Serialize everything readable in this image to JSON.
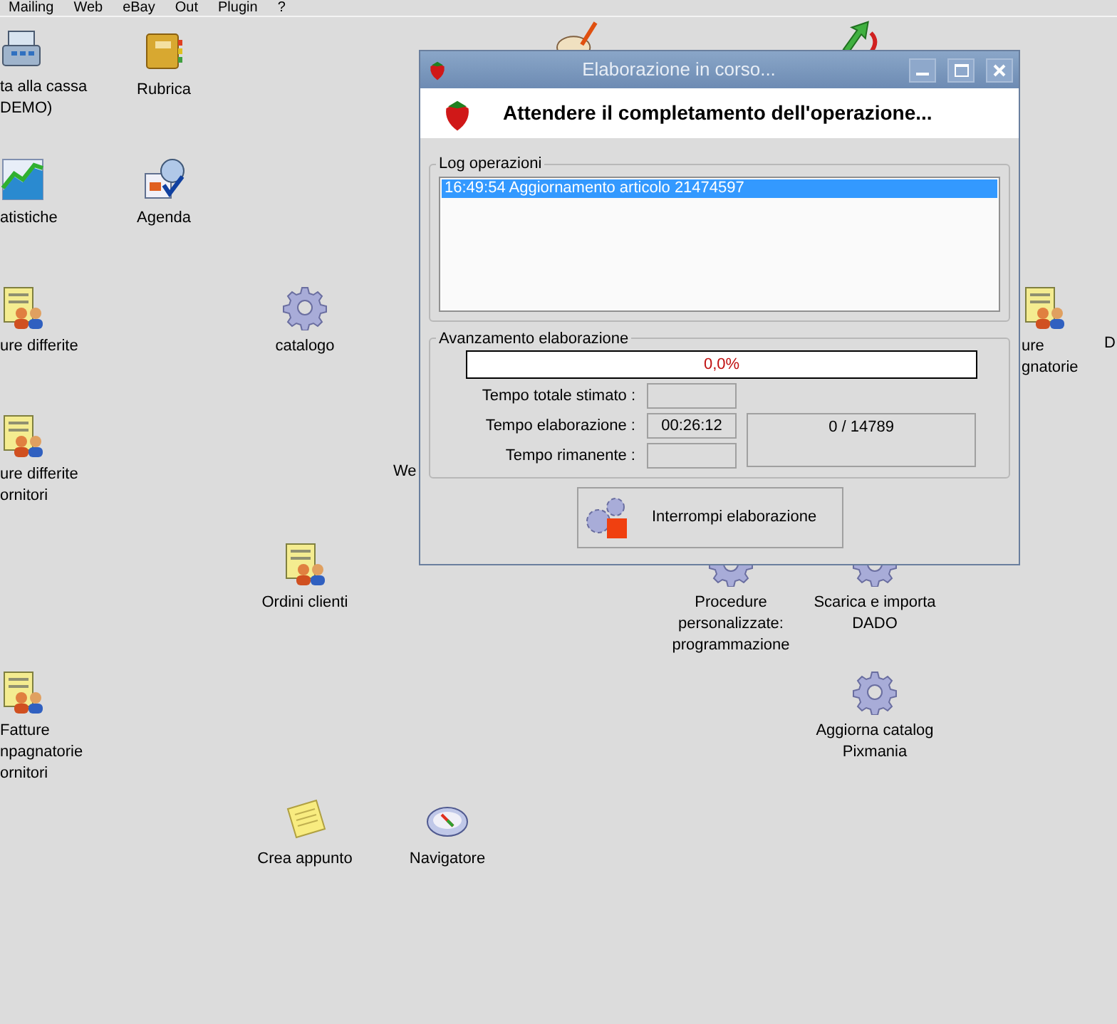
{
  "menu_bar": [
    "Mailing",
    "Web",
    "eBay",
    "Out",
    "Plugin",
    "?"
  ],
  "desktop_icons": [
    {
      "kind": "register",
      "label": [
        "ta alla cassa",
        "DEMO)"
      ]
    },
    {
      "kind": "book",
      "label": [
        "Rubrica"
      ]
    },
    {
      "kind": "chart",
      "label": [
        "atistiche"
      ]
    },
    {
      "kind": "calendar",
      "label": [
        "Agenda"
      ]
    },
    {
      "kind": "document-people",
      "label": [
        "ure differite"
      ]
    },
    {
      "kind": "gear",
      "label": [
        "catalogo"
      ]
    },
    {
      "kind": "document-people",
      "label": [
        "ure differite",
        "ornitori"
      ]
    },
    {
      "kind": "none",
      "label": [
        "We"
      ]
    },
    {
      "kind": "document-people",
      "label": [
        "Ordini clienti"
      ]
    },
    {
      "kind": "document-people",
      "label": [
        "Fatture",
        "npagnatorie",
        "ornitori"
      ]
    },
    {
      "kind": "note",
      "label": [
        "Crea appunto"
      ]
    },
    {
      "kind": "compass",
      "label": [
        "Navigatore"
      ]
    },
    {
      "kind": "gear",
      "label": [
        "Procedure",
        "personalizzate:",
        "programmazione"
      ]
    },
    {
      "kind": "gear",
      "label": [
        "Scarica e importa",
        "DADO"
      ]
    },
    {
      "kind": "gear",
      "label": [
        "Aggiorna catalog",
        "Pixmania"
      ]
    },
    {
      "kind": "document-people",
      "label": [
        "ure",
        "gnatorie"
      ]
    },
    {
      "kind": "none",
      "label": [
        "D"
      ]
    },
    {
      "kind": "paint"
    },
    {
      "kind": "arrow"
    }
  ],
  "dialog": {
    "title": "Elaborazione in corso...",
    "heading": "Attendere il completamento dell'operazione...",
    "log": {
      "legend": "Log operazioni",
      "entries": [
        {
          "text": "16:49:54 Aggiornamento articolo 21474597",
          "selected": true
        }
      ]
    },
    "progress": {
      "legend": "Avanzamento elaborazione",
      "level": 0.0,
      "reading": "0,0%",
      "fields": [
        {
          "label": "Tempo totale stimato :"
        },
        {
          "label": "Tempo elaborazione :",
          "value": "00:26:12"
        },
        {
          "label": "Tempo rimanente :"
        }
      ],
      "count": "0 / 14789"
    },
    "button": "Interrompi elaborazione"
  }
}
